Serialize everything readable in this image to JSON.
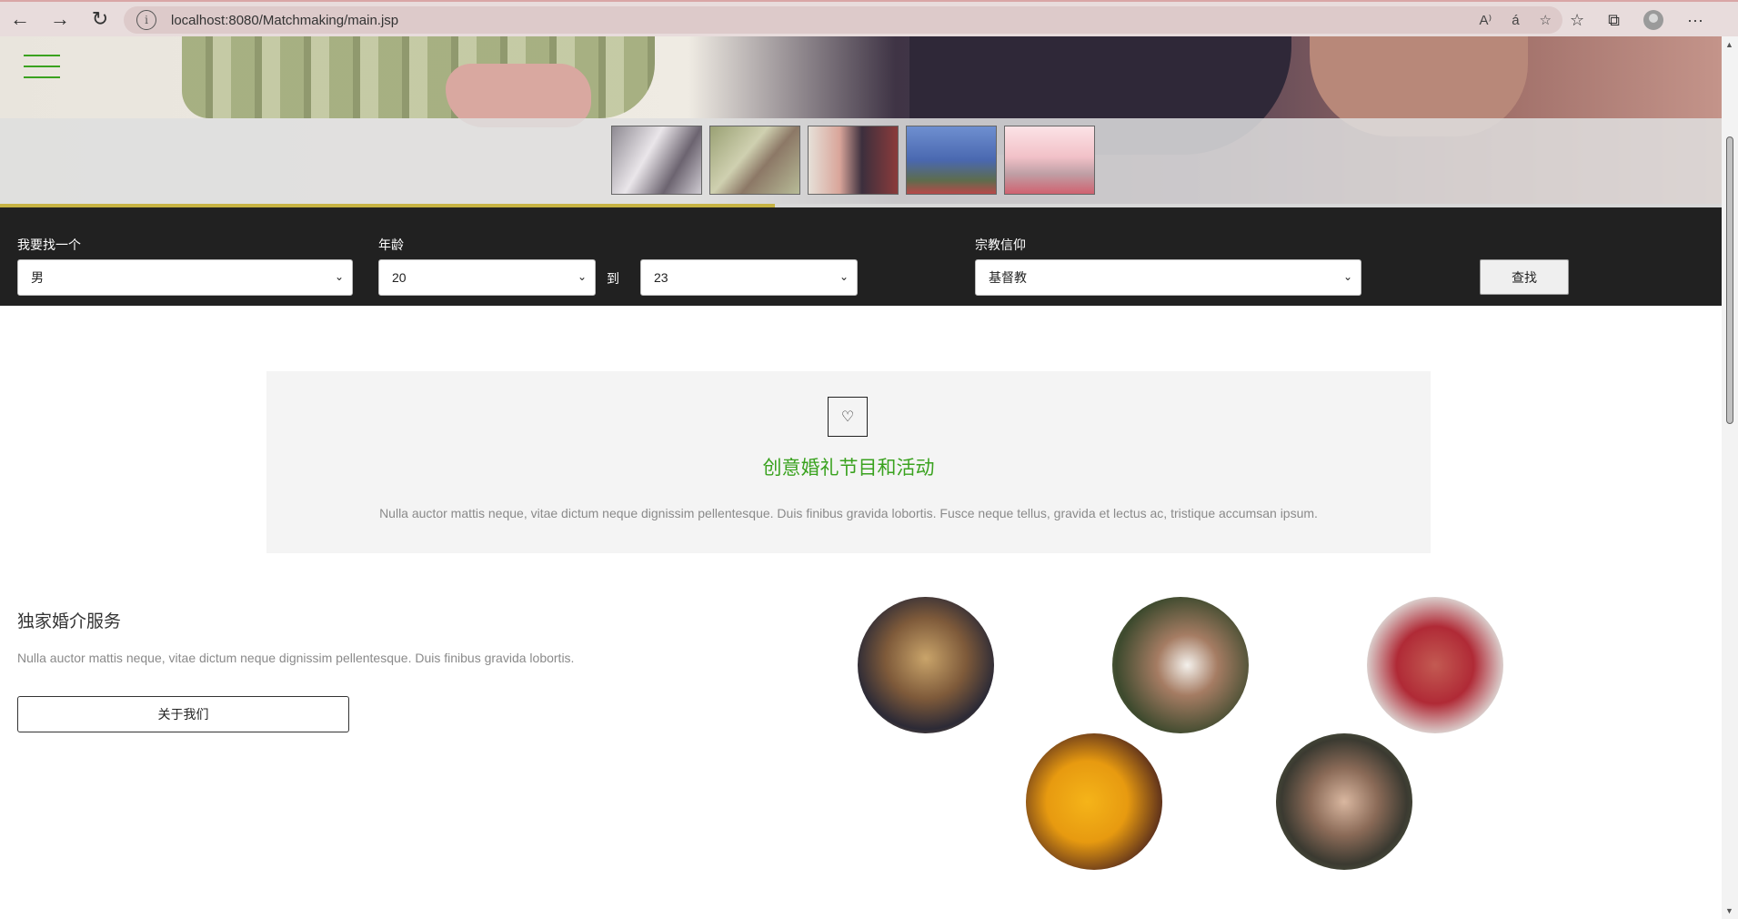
{
  "browser": {
    "url": "localhost:8080/Matchmaking/main.jsp",
    "back_icon": "←",
    "forward_icon": "→",
    "reload_icon": "↻",
    "info_icon": "i",
    "read_aloud_icon": "A⁾",
    "translate_icon": "á",
    "favorite_icon": "☆",
    "favorites_icon": "☆",
    "collections_icon": "⧉",
    "more_icon": "···"
  },
  "hero": {
    "progress_fraction": 0.45,
    "thumbnails": [
      "t1",
      "t2",
      "t3",
      "t4",
      "t5"
    ]
  },
  "search": {
    "looking_for_label": "我要找一个",
    "looking_for_value": "男",
    "age_label": "年龄",
    "age_min_value": "20",
    "to_label": "到",
    "age_max_value": "23",
    "religion_label": "宗教信仰",
    "religion_value": "基督教",
    "search_button": "查找"
  },
  "feature": {
    "icon": "♡",
    "title": "创意婚礼节目和活动",
    "text": "Nulla auctor mattis neque, vitae dictum neque dignissim pellentesque. Duis finibus gravida lobortis. Fusce neque tellus, gravida et lectus ac, tristique accumsan ipsum."
  },
  "services": {
    "title": "独家婚介服务",
    "text": "Nulla auctor mattis neque, vitae dictum neque dignissim pellentesque. Duis finibus gravida lobortis.",
    "about_button": "关于我们"
  },
  "colors": {
    "accent_green": "#3aa21f",
    "search_bar_bg": "#212121",
    "progress_color": "#c6b343"
  }
}
